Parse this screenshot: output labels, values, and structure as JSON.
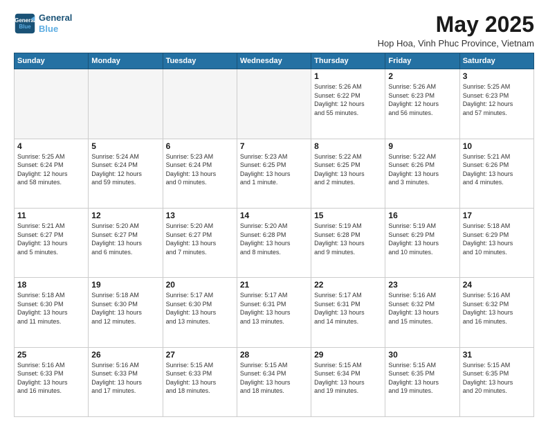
{
  "header": {
    "logo_line1": "General",
    "logo_line2": "Blue",
    "month": "May 2025",
    "location": "Hop Hoa, Vinh Phuc Province, Vietnam"
  },
  "days_of_week": [
    "Sunday",
    "Monday",
    "Tuesday",
    "Wednesday",
    "Thursday",
    "Friday",
    "Saturday"
  ],
  "weeks": [
    [
      {
        "day": "",
        "info": ""
      },
      {
        "day": "",
        "info": ""
      },
      {
        "day": "",
        "info": ""
      },
      {
        "day": "",
        "info": ""
      },
      {
        "day": "1",
        "info": "Sunrise: 5:26 AM\nSunset: 6:22 PM\nDaylight: 12 hours\nand 55 minutes."
      },
      {
        "day": "2",
        "info": "Sunrise: 5:26 AM\nSunset: 6:23 PM\nDaylight: 12 hours\nand 56 minutes."
      },
      {
        "day": "3",
        "info": "Sunrise: 5:25 AM\nSunset: 6:23 PM\nDaylight: 12 hours\nand 57 minutes."
      }
    ],
    [
      {
        "day": "4",
        "info": "Sunrise: 5:25 AM\nSunset: 6:24 PM\nDaylight: 12 hours\nand 58 minutes."
      },
      {
        "day": "5",
        "info": "Sunrise: 5:24 AM\nSunset: 6:24 PM\nDaylight: 12 hours\nand 59 minutes."
      },
      {
        "day": "6",
        "info": "Sunrise: 5:23 AM\nSunset: 6:24 PM\nDaylight: 13 hours\nand 0 minutes."
      },
      {
        "day": "7",
        "info": "Sunrise: 5:23 AM\nSunset: 6:25 PM\nDaylight: 13 hours\nand 1 minute."
      },
      {
        "day": "8",
        "info": "Sunrise: 5:22 AM\nSunset: 6:25 PM\nDaylight: 13 hours\nand 2 minutes."
      },
      {
        "day": "9",
        "info": "Sunrise: 5:22 AM\nSunset: 6:26 PM\nDaylight: 13 hours\nand 3 minutes."
      },
      {
        "day": "10",
        "info": "Sunrise: 5:21 AM\nSunset: 6:26 PM\nDaylight: 13 hours\nand 4 minutes."
      }
    ],
    [
      {
        "day": "11",
        "info": "Sunrise: 5:21 AM\nSunset: 6:27 PM\nDaylight: 13 hours\nand 5 minutes."
      },
      {
        "day": "12",
        "info": "Sunrise: 5:20 AM\nSunset: 6:27 PM\nDaylight: 13 hours\nand 6 minutes."
      },
      {
        "day": "13",
        "info": "Sunrise: 5:20 AM\nSunset: 6:27 PM\nDaylight: 13 hours\nand 7 minutes."
      },
      {
        "day": "14",
        "info": "Sunrise: 5:20 AM\nSunset: 6:28 PM\nDaylight: 13 hours\nand 8 minutes."
      },
      {
        "day": "15",
        "info": "Sunrise: 5:19 AM\nSunset: 6:28 PM\nDaylight: 13 hours\nand 9 minutes."
      },
      {
        "day": "16",
        "info": "Sunrise: 5:19 AM\nSunset: 6:29 PM\nDaylight: 13 hours\nand 10 minutes."
      },
      {
        "day": "17",
        "info": "Sunrise: 5:18 AM\nSunset: 6:29 PM\nDaylight: 13 hours\nand 10 minutes."
      }
    ],
    [
      {
        "day": "18",
        "info": "Sunrise: 5:18 AM\nSunset: 6:30 PM\nDaylight: 13 hours\nand 11 minutes."
      },
      {
        "day": "19",
        "info": "Sunrise: 5:18 AM\nSunset: 6:30 PM\nDaylight: 13 hours\nand 12 minutes."
      },
      {
        "day": "20",
        "info": "Sunrise: 5:17 AM\nSunset: 6:30 PM\nDaylight: 13 hours\nand 13 minutes."
      },
      {
        "day": "21",
        "info": "Sunrise: 5:17 AM\nSunset: 6:31 PM\nDaylight: 13 hours\nand 13 minutes."
      },
      {
        "day": "22",
        "info": "Sunrise: 5:17 AM\nSunset: 6:31 PM\nDaylight: 13 hours\nand 14 minutes."
      },
      {
        "day": "23",
        "info": "Sunrise: 5:16 AM\nSunset: 6:32 PM\nDaylight: 13 hours\nand 15 minutes."
      },
      {
        "day": "24",
        "info": "Sunrise: 5:16 AM\nSunset: 6:32 PM\nDaylight: 13 hours\nand 16 minutes."
      }
    ],
    [
      {
        "day": "25",
        "info": "Sunrise: 5:16 AM\nSunset: 6:33 PM\nDaylight: 13 hours\nand 16 minutes."
      },
      {
        "day": "26",
        "info": "Sunrise: 5:16 AM\nSunset: 6:33 PM\nDaylight: 13 hours\nand 17 minutes."
      },
      {
        "day": "27",
        "info": "Sunrise: 5:15 AM\nSunset: 6:33 PM\nDaylight: 13 hours\nand 18 minutes."
      },
      {
        "day": "28",
        "info": "Sunrise: 5:15 AM\nSunset: 6:34 PM\nDaylight: 13 hours\nand 18 minutes."
      },
      {
        "day": "29",
        "info": "Sunrise: 5:15 AM\nSunset: 6:34 PM\nDaylight: 13 hours\nand 19 minutes."
      },
      {
        "day": "30",
        "info": "Sunrise: 5:15 AM\nSunset: 6:35 PM\nDaylight: 13 hours\nand 19 minutes."
      },
      {
        "day": "31",
        "info": "Sunrise: 5:15 AM\nSunset: 6:35 PM\nDaylight: 13 hours\nand 20 minutes."
      }
    ]
  ]
}
